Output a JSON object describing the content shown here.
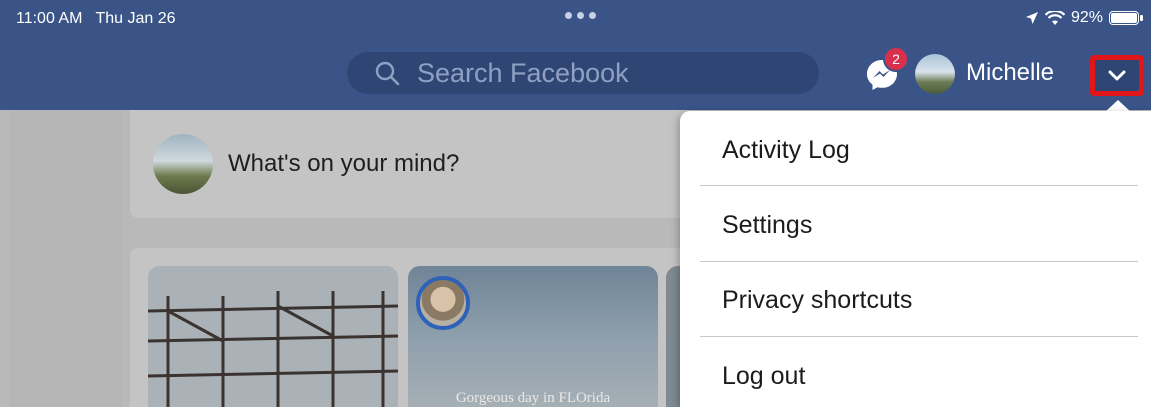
{
  "status_bar": {
    "time": "11:00 AM",
    "date": "Thu Jan 26",
    "battery": "92%"
  },
  "nav": {
    "search_placeholder": "Search Facebook",
    "messenger_badge": "2",
    "user_name": "Michelle"
  },
  "composer": {
    "prompt": "What's on your mind?"
  },
  "stories": [
    {
      "caption": ""
    },
    {
      "caption": "Gorgeous day in FLOrida"
    }
  ],
  "menu": {
    "items": [
      {
        "label": "Activity Log"
      },
      {
        "label": "Settings"
      },
      {
        "label": "Privacy shortcuts"
      },
      {
        "label": "Log out"
      }
    ]
  },
  "colors": {
    "nav_bg": "#3a5488",
    "highlight": "#e0161b",
    "badge": "#d9304e"
  }
}
